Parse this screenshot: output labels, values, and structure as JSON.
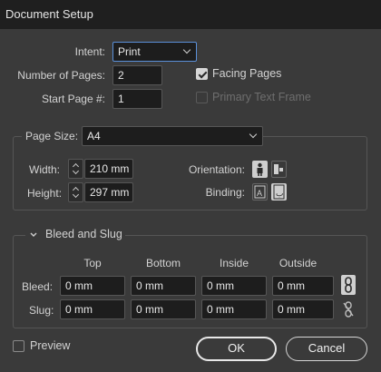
{
  "window": {
    "title": "Document Setup"
  },
  "intent": {
    "label": "Intent:",
    "value": "Print"
  },
  "pages": {
    "label": "Number of Pages:",
    "value": "2"
  },
  "start_page": {
    "label": "Start Page #:",
    "value": "1"
  },
  "facing_pages": {
    "label": "Facing Pages",
    "checked": true
  },
  "primary_text_frame": {
    "label": "Primary Text Frame",
    "checked": false,
    "disabled": true
  },
  "page_size": {
    "label": "Page Size:",
    "value": "A4",
    "width_label": "Width:",
    "width_value": "210 mm",
    "height_label": "Height:",
    "height_value": "297 mm",
    "orientation_label": "Orientation:",
    "binding_label": "Binding:",
    "orientation_icons": [
      "portrait-icon",
      "landscape-icon"
    ],
    "binding_icons": [
      "left-to-right-binding-icon",
      "right-to-left-binding-icon"
    ]
  },
  "bleed_slug": {
    "title": "Bleed and Slug",
    "columns": [
      "Top",
      "Bottom",
      "Inside",
      "Outside"
    ],
    "bleed_label": "Bleed:",
    "bleed_values": [
      "0 mm",
      "0 mm",
      "0 mm",
      "0 mm"
    ],
    "slug_label": "Slug:",
    "slug_values": [
      "0 mm",
      "0 mm",
      "0 mm",
      "0 mm"
    ]
  },
  "preview": {
    "label": "Preview",
    "checked": false
  },
  "buttons": {
    "ok": "OK",
    "cancel": "Cancel"
  },
  "colors": {
    "background": "#3a3a3a",
    "titlebar": "#1f1f1f",
    "field": "#1d1d1d",
    "focus": "#5a8fd8"
  }
}
